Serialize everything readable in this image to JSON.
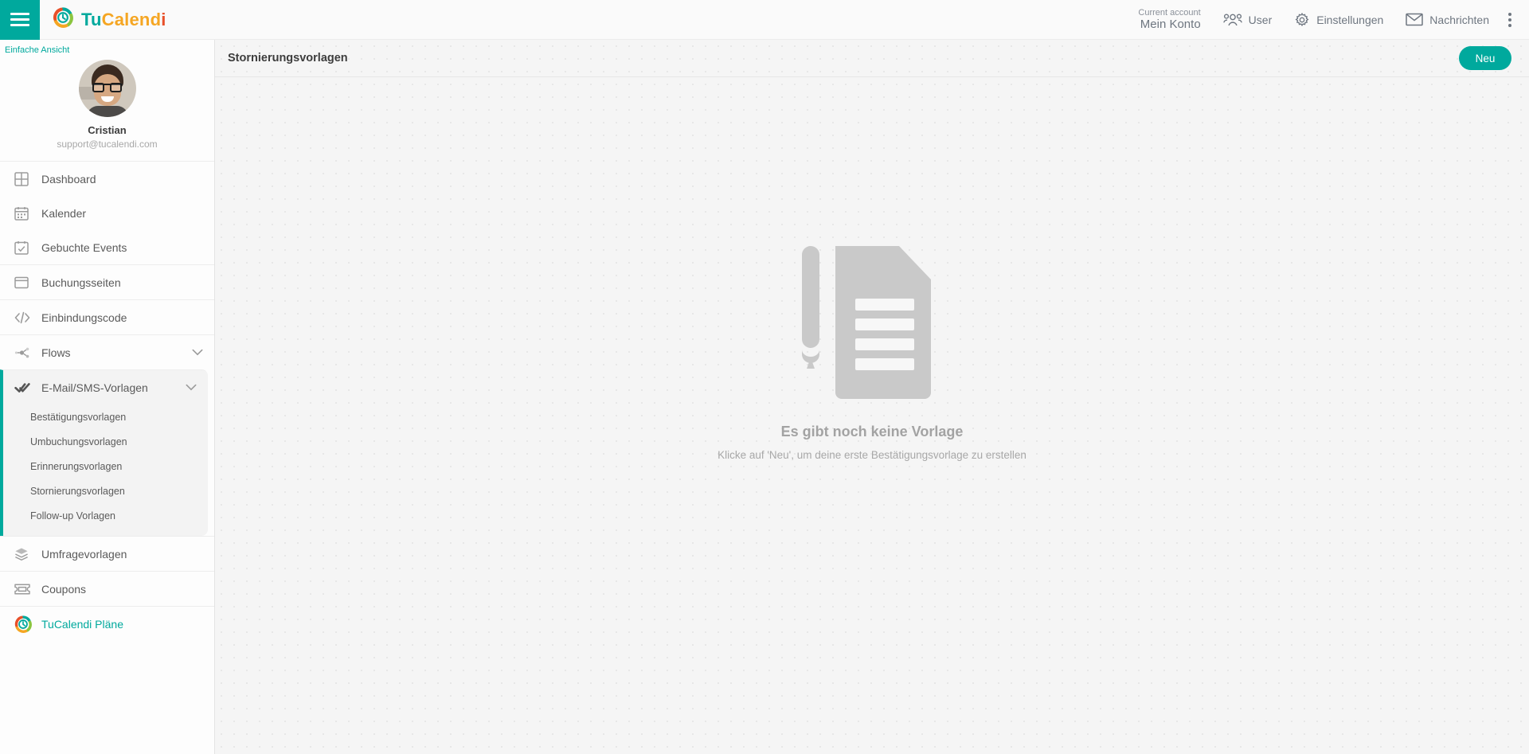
{
  "topbar": {
    "hamburger": "menu",
    "brand": {
      "part1": "Tu",
      "part2": "Calend",
      "part3": "i"
    },
    "account": {
      "label": "Current account",
      "value": "Mein Konto"
    },
    "nav": [
      {
        "label": "User",
        "icon": "users-icon"
      },
      {
        "label": "Einstellungen",
        "icon": "gear-icon"
      },
      {
        "label": "Nachrichten",
        "icon": "envelope-icon"
      }
    ],
    "kebab": "more-options"
  },
  "sidebar": {
    "simple_view": "Einfache Ansicht",
    "profile": {
      "name": "Cristian",
      "email": "support@tucalendi.com"
    },
    "groups": [
      {
        "items": [
          {
            "label": "Dashboard",
            "icon": "dashboard-icon"
          },
          {
            "label": "Kalender",
            "icon": "calendar-icon"
          },
          {
            "label": "Gebuchte Events",
            "icon": "calendar-check-icon"
          }
        ]
      },
      {
        "items": [
          {
            "label": "Buchungsseiten",
            "icon": "window-icon"
          }
        ]
      },
      {
        "items": [
          {
            "label": "Einbindungscode",
            "icon": "code-icon"
          }
        ]
      },
      {
        "items": [
          {
            "label": "Flows",
            "icon": "flow-icon",
            "expandable": true
          }
        ]
      }
    ],
    "active_section": {
      "label": "E-Mail/SMS-Vorlagen",
      "icon": "double-check-icon",
      "expandable": true,
      "subitems": [
        {
          "label": "Bestätigungsvorlagen"
        },
        {
          "label": "Umbuchungsvorlagen"
        },
        {
          "label": "Erinnerungsvorlagen"
        },
        {
          "label": "Stornierungsvorlagen"
        },
        {
          "label": "Follow-up Vorlagen"
        }
      ]
    },
    "bottom_groups": [
      {
        "items": [
          {
            "label": "Umfragevorlagen",
            "icon": "layers-icon"
          }
        ]
      },
      {
        "items": [
          {
            "label": "Coupons",
            "icon": "ticket-icon"
          }
        ]
      },
      {
        "items": [
          {
            "label": "TuCalendi Pläne",
            "icon": "tucalendi-logo-icon"
          }
        ]
      }
    ]
  },
  "main": {
    "title": "Stornierungsvorlagen",
    "new_button": "Neu",
    "empty_state": {
      "icon": "document-pen-icon",
      "title": "Es gibt noch keine Vorlage",
      "subtitle": "Klicke auf 'Neu', um deine erste Bestätigungsvorlage zu erstellen"
    }
  },
  "colors": {
    "accent": "#00a99d",
    "brand_orange": "#f5a623",
    "brand_red": "#e8502a",
    "brand_green": "#8bc53f"
  }
}
